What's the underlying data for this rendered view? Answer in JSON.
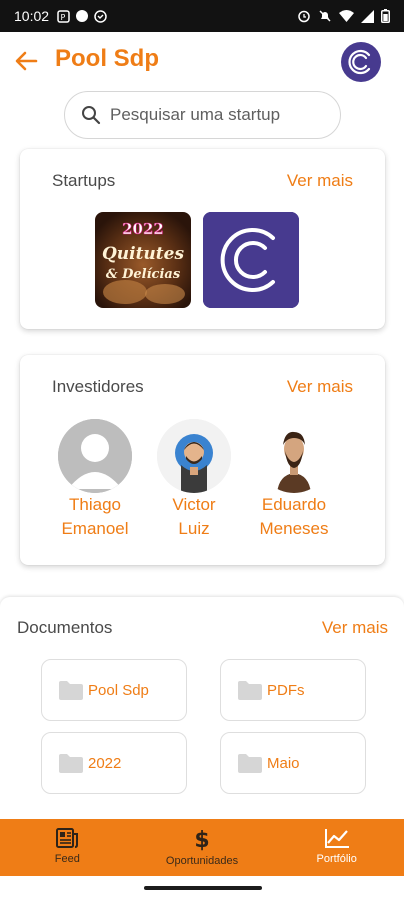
{
  "status_bar": {
    "time": "10:02"
  },
  "header": {
    "title": "Pool Sdp"
  },
  "search": {
    "placeholder": "Pesquisar uma startup"
  },
  "startups": {
    "title": "Startups",
    "see_more": "Ver mais",
    "items": [
      {
        "logo_text_1": "2022",
        "logo_text_2": "Quitutes",
        "logo_text_3": "& Delícias"
      },
      {
        "logo_letter": "C"
      }
    ]
  },
  "investors": {
    "title": "Investidores",
    "see_more": "Ver mais",
    "items": [
      {
        "first": "Thiago",
        "last": "Emanoel"
      },
      {
        "first": "Victor",
        "last": "Luiz"
      },
      {
        "first": "Eduardo",
        "last": "Meneses"
      }
    ]
  },
  "documents": {
    "title": "Documentos",
    "see_more": "Ver mais",
    "folders": [
      "Pool Sdp",
      "PDFs",
      "2022",
      "Maio"
    ]
  },
  "bottom_nav": {
    "items": [
      {
        "label": "Feed",
        "icon": "feed-icon"
      },
      {
        "label": "Oportunidades",
        "icon": "dollar-icon"
      },
      {
        "label": "Portfólio",
        "icon": "chart-icon"
      }
    ],
    "active": "Portfólio"
  },
  "colors": {
    "accent": "#ef7d16",
    "brand_purple": "#473a8f"
  }
}
